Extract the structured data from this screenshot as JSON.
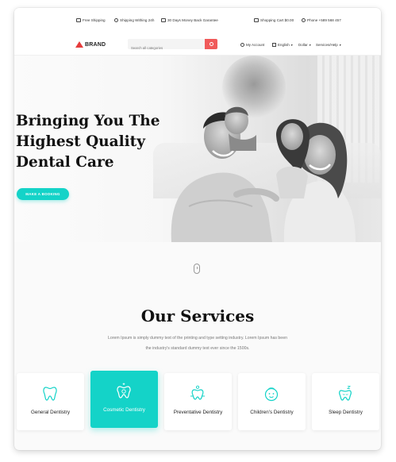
{
  "topbar": {
    "free_shipping": "Free Shipping",
    "shipping_within": "Shipping Withing 24h",
    "money_back": "30 Days Money Back Garantee",
    "cart": "Shopping Cart $0.00",
    "phone": "Phone +589 568 457"
  },
  "nav": {
    "brand": "BRAND",
    "search_placeholder": "Search all categories",
    "account": "My Account",
    "language": "English",
    "currency": "Dollar",
    "services_help": "Services/Help"
  },
  "hero": {
    "title_lines": [
      "Bringing You The",
      "Highest Quality",
      "Dental Care"
    ],
    "button": "MAKE A BOOKING"
  },
  "services": {
    "title": "Our Services",
    "description": "Lorem Ipsum is simply dummy text of the printing and type setting industry. Lorem Ipsum has been the industry's standard dummy text ever since the 1500s.",
    "items": [
      {
        "label": "General Dentistry",
        "icon": "tooth-icon",
        "active": false
      },
      {
        "label": "Cosmetic Dentistry",
        "icon": "tooth-sparkle-icon",
        "active": true
      },
      {
        "label": "Preventative Dentistry",
        "icon": "tooth-care-icon",
        "active": false
      },
      {
        "label": "Children's Dentistry",
        "icon": "child-face-icon",
        "active": false
      },
      {
        "label": "Sleep Dentistry",
        "icon": "sleeping-tooth-icon",
        "active": false
      }
    ]
  },
  "colors": {
    "accent": "#14d3c8",
    "brand_red": "#e63c3c",
    "search_button": "#f05a5a"
  }
}
